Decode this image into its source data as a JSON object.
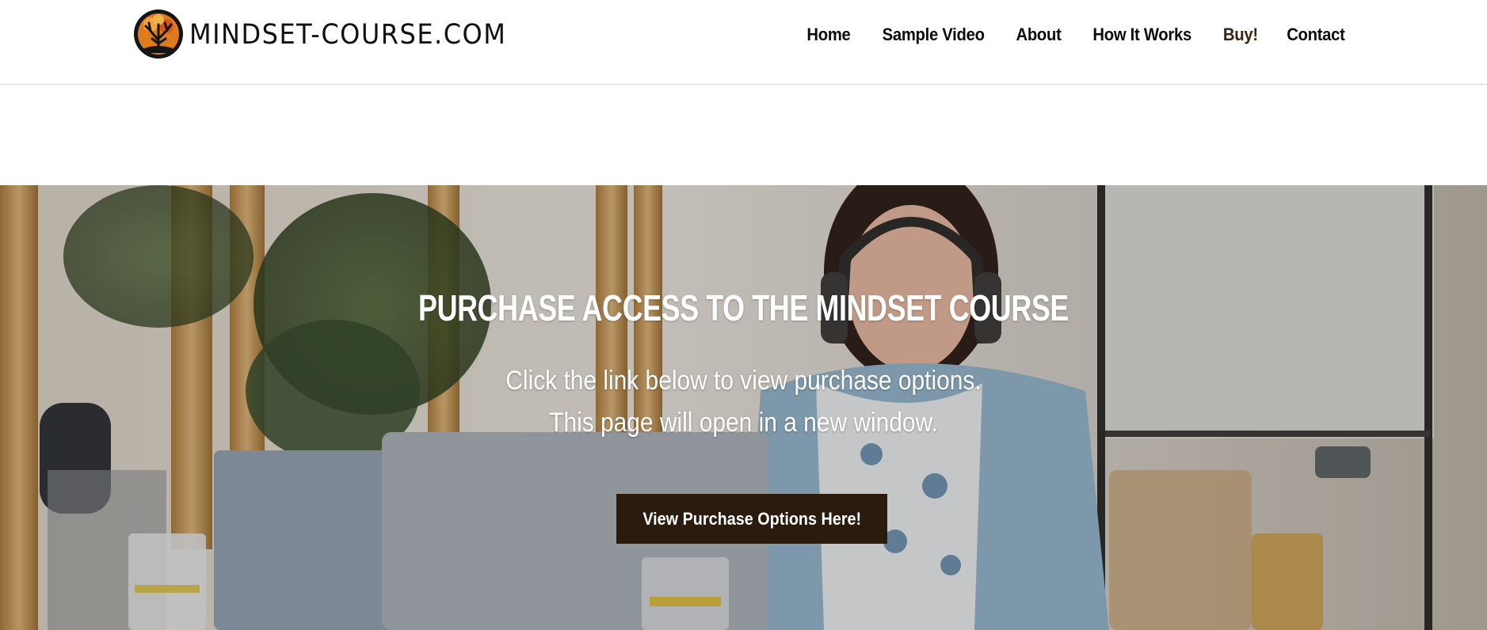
{
  "header": {
    "logo_text": "MINDSET-COURSE.COM",
    "nav": {
      "home": "Home",
      "sample_video": "Sample Video",
      "about": "About",
      "how_it_works": "How It Works",
      "buy": "Buy!",
      "contact": "Contact"
    }
  },
  "hero": {
    "title": "Purchase Access to the Mindset Course",
    "line1": "Click the link below to view purchase options.",
    "line2": "This page will open in a new window.",
    "button_label": "View Purchase Options Here!"
  },
  "colors": {
    "button_bg": "#2b1a0e",
    "buy_link": "#3a2410",
    "logo_orange": "#e07a1f"
  },
  "icons": {
    "logo_mark": "tree-in-circle-icon"
  }
}
